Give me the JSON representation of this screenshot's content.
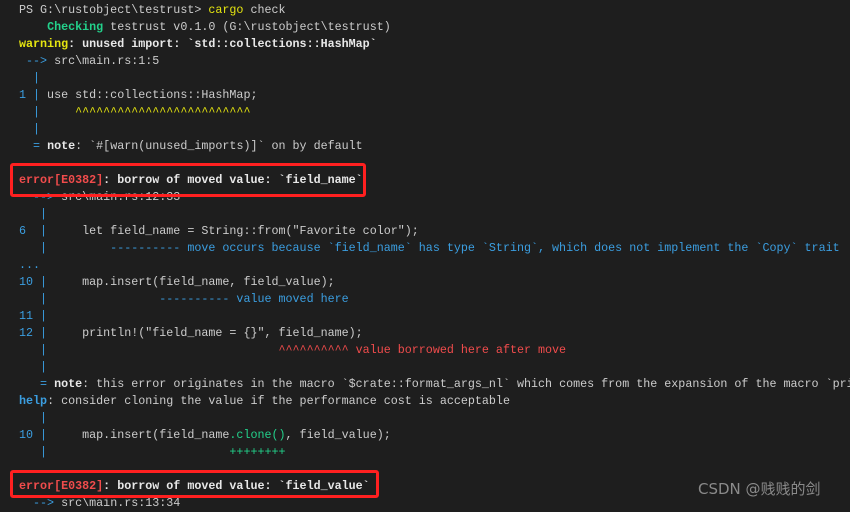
{
  "colors": {
    "background": "#1e1e1e",
    "error": "#f14c4c",
    "warning": "#e5e510",
    "info": "#3b9ee0",
    "success": "#23d18b",
    "highlight_box": "#ff2020"
  },
  "terminal": {
    "lines": [
      [
        [
          "PS G:\\rustobject\\testrust> ",
          ""
        ],
        [
          "cargo",
          "y"
        ],
        [
          " check",
          ""
        ]
      ],
      [
        [
          "    ",
          ""
        ],
        [
          "Checking",
          "gb"
        ],
        [
          " testrust v0.1.0 (G:\\rustobject\\testrust)",
          ""
        ]
      ],
      [
        [
          "warning",
          "yb"
        ],
        [
          ": unused import: `std::collections::HashMap`",
          "w"
        ]
      ],
      [
        [
          " --> ",
          "b"
        ],
        [
          "src\\main.rs:1:5",
          ""
        ]
      ],
      [
        [
          "  |",
          "b"
        ]
      ],
      [
        [
          "1 |",
          "b"
        ],
        [
          " use std::collections::HashMap;",
          ""
        ]
      ],
      [
        [
          "  |",
          "b"
        ],
        [
          "     ^^^^^^^^^^^^^^^^^^^^^^^^^",
          "y"
        ]
      ],
      [
        [
          "  |",
          "b"
        ]
      ],
      [
        [
          "  = ",
          "b"
        ],
        [
          "note",
          "w"
        ],
        [
          ": `#[warn(unused_imports)]` on by default",
          ""
        ]
      ],
      [],
      [
        [
          "error[E0382]",
          "rb"
        ],
        [
          ": borrow of moved value: `field_name`",
          "w"
        ]
      ],
      [
        [
          "  --> ",
          "b"
        ],
        [
          "src\\main.rs:12:33",
          ""
        ]
      ],
      [
        [
          "   |",
          "b"
        ]
      ],
      [
        [
          "6  |",
          "b"
        ],
        [
          "     let field_name = String::from(\"Favorite color\");",
          ""
        ]
      ],
      [
        [
          "   |",
          "b"
        ],
        [
          "         ---------- move occurs because `field_name` has type `String`, which does not implement the `Copy` trait",
          "b"
        ]
      ],
      [
        [
          "...",
          "b"
        ]
      ],
      [
        [
          "10 |",
          "b"
        ],
        [
          "     map.insert(field_name, field_value);",
          ""
        ]
      ],
      [
        [
          "   |",
          "b"
        ],
        [
          "                ---------- value moved here",
          "b"
        ]
      ],
      [
        [
          "11 |",
          "b"
        ]
      ],
      [
        [
          "12 |",
          "b"
        ],
        [
          "     println!(\"field_name = {}\", field_name);",
          ""
        ]
      ],
      [
        [
          "   |",
          "b"
        ],
        [
          "                                 ^^^^^^^^^^ value borrowed here after move",
          "r"
        ]
      ],
      [
        [
          "   |",
          "b"
        ]
      ],
      [
        [
          "   = ",
          "b"
        ],
        [
          "note",
          "w"
        ],
        [
          ": this error originates in the macro `$crate::format_args_nl` which comes from the expansion of the macro `pri",
          ""
        ]
      ],
      [
        [
          "help",
          "bb"
        ],
        [
          ": consider cloning the value if the performance cost is acceptable",
          ""
        ]
      ],
      [
        [
          "   |",
          "b"
        ]
      ],
      [
        [
          "10 |",
          "b"
        ],
        [
          "     map.insert(field_name",
          ""
        ],
        [
          ".clone()",
          "g"
        ],
        [
          ", field_value);",
          ""
        ]
      ],
      [
        [
          "   |",
          "b"
        ],
        [
          "                          ++++++++",
          "g"
        ]
      ],
      [],
      [
        [
          "error[E0382]",
          "rb"
        ],
        [
          ": borrow of moved value: `field_value`",
          "w"
        ]
      ],
      [
        [
          "  --> ",
          "b"
        ],
        [
          "src\\main.rs:13:34",
          ""
        ]
      ]
    ]
  },
  "watermark": "CSDN @贱贱的剑"
}
